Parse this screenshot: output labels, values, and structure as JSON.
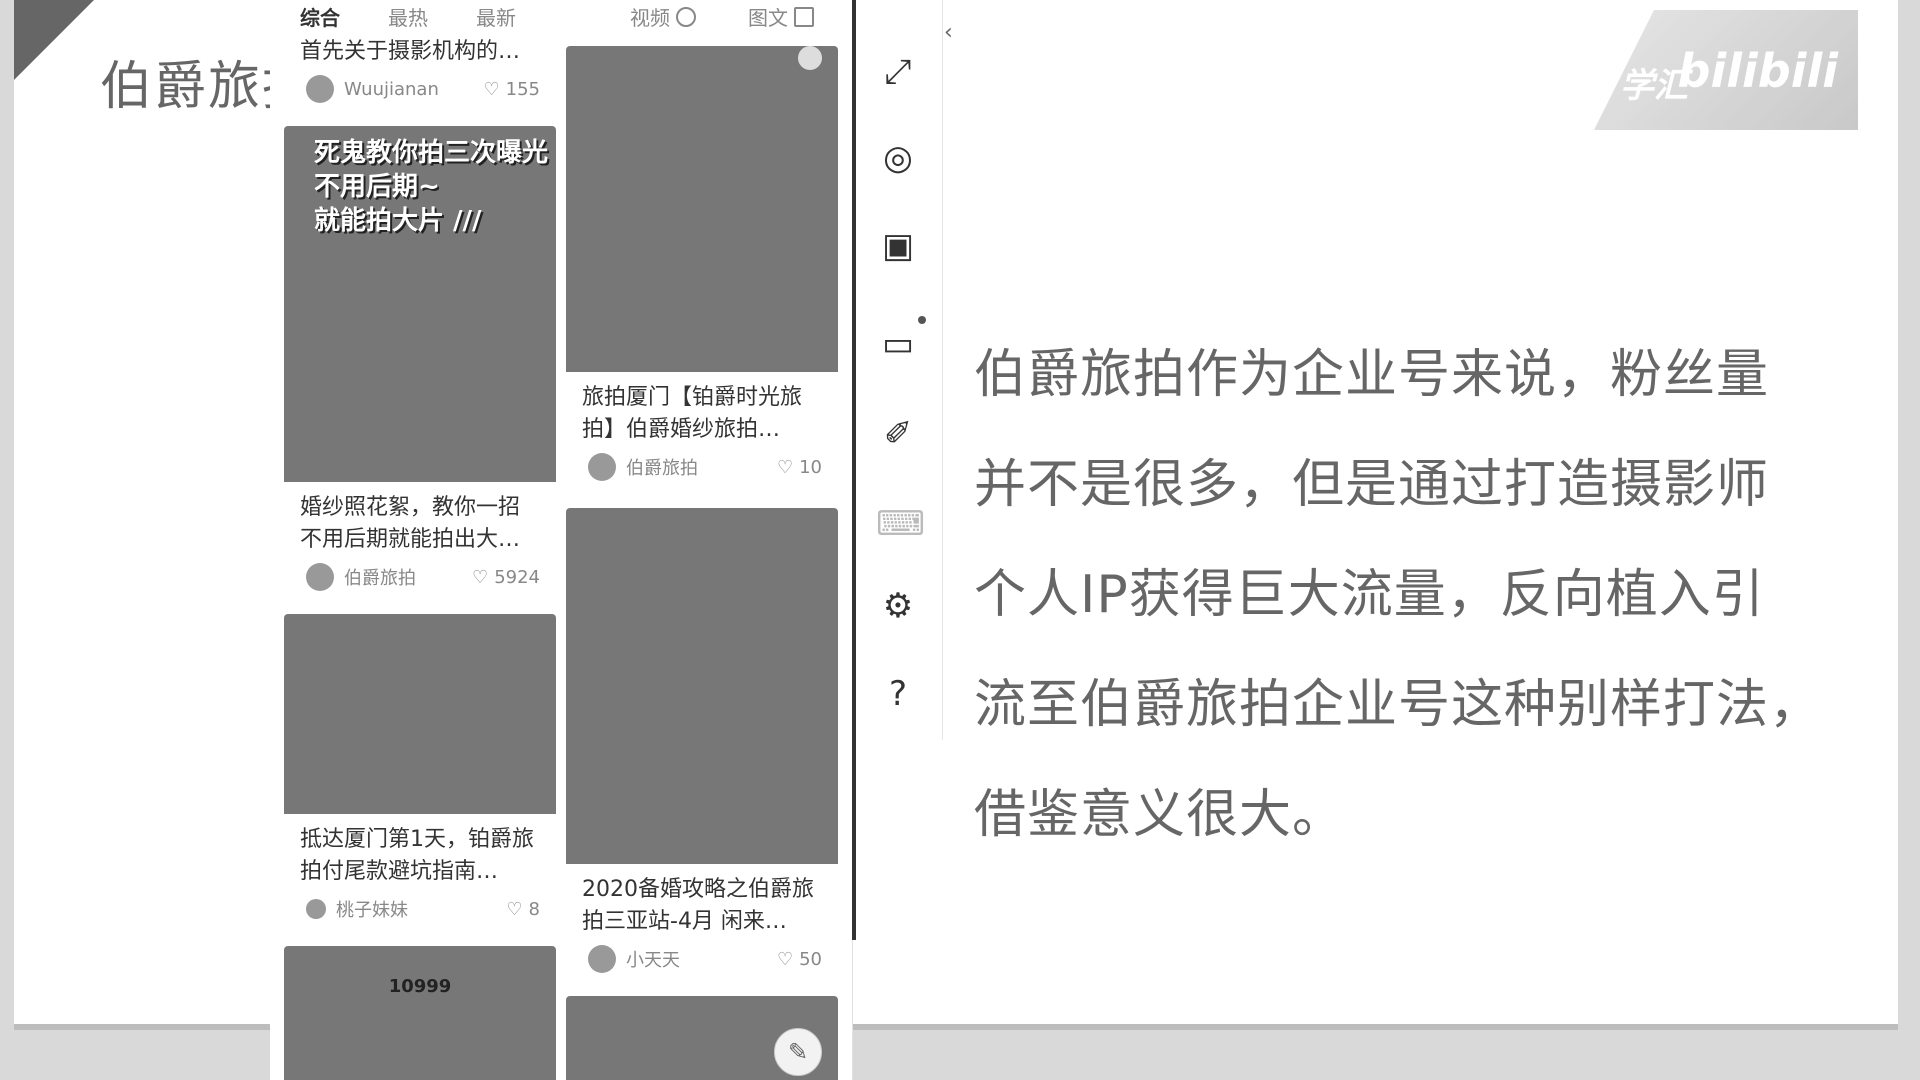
{
  "slide": {
    "title": "伯爵旅拍",
    "body_lines": [
      "伯爵旅拍作为企业号来说，粉丝量",
      "并不是很多，但是通过打造摄影师",
      "个人IP获得巨大流量，反向植入引",
      "流至伯爵旅拍企业号这种别样打法，",
      "借鉴意义很大。"
    ],
    "watermark": "bilibili",
    "watermark_cn": "学汇"
  },
  "feed": {
    "tabs": [
      "综合",
      "最热",
      "最新",
      "视频",
      "图文"
    ],
    "cards": [
      {
        "title": "首先关于摄影机构的…",
        "author": "Wuujianan",
        "likes": "155"
      },
      {
        "title": "婚纱照花絮，教你一招不用后期就能拍出大…",
        "author": "伯爵旅拍",
        "likes": "5924",
        "overlay": [
          "死鬼教你拍三次曝光",
          "不用后期~",
          "就能拍大片 ///"
        ]
      },
      {
        "title": "抵达厦门第1天，铂爵旅拍付尾款避坑指南…",
        "author": "桃子妹妹",
        "likes": "8"
      },
      {
        "title": "旅拍厦门【铂爵时光旅拍】伯爵婚纱旅拍…",
        "author": "伯爵旅拍",
        "likes": "10"
      },
      {
        "title": "2020备婚攻略之伯爵旅拍三亚站-4月 闲来…",
        "author": "小天天",
        "likes": "50"
      }
    ],
    "table_card": {
      "number": "10999"
    }
  },
  "toolbar": {
    "icons": [
      "expand-icon",
      "camera-icon",
      "video-camera-icon",
      "screen-share-icon",
      "brush-icon",
      "keyboard-icon",
      "gear-icon",
      "help-icon"
    ]
  }
}
